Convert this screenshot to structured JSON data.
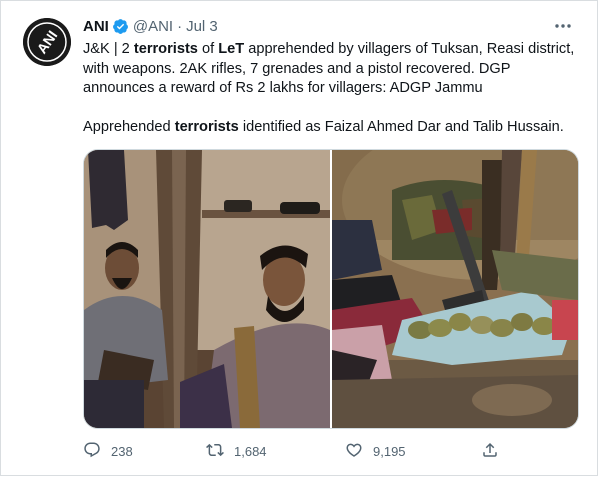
{
  "tweet": {
    "author_name": "ANI",
    "handle": "@ANI",
    "separator": "·",
    "date": "Jul 3",
    "line1_before": "J&K | 2 ",
    "line1_bold1": "terrorists",
    "line1_mid": " of ",
    "line1_bold2": "LeT",
    "line1_after": " apprehended by villagers of Tuksan, Reasi district, with weapons. 2AK rifles, 7 grenades and a pistol recovered. DGP announces a reward of Rs 2 lakhs for villagers: ADGP Jammu",
    "line2_before": "Apprehended ",
    "line2_bold": "terrorists",
    "line2_after": " identified as Faizal Ahmed Dar and Talib Hussain.",
    "avatar_text": "ANI"
  },
  "actions": {
    "replies": "238",
    "retweets": "1,684",
    "likes": "9,195"
  },
  "icons": {
    "verified": "verified-badge-icon",
    "more": "more-options-icon",
    "reply": "reply-icon",
    "retweet": "retweet-icon",
    "like": "heart-icon",
    "share": "share-icon"
  },
  "colors": {
    "verified": "#1d9bf0",
    "text": "#0f1419",
    "muted": "#536471"
  }
}
